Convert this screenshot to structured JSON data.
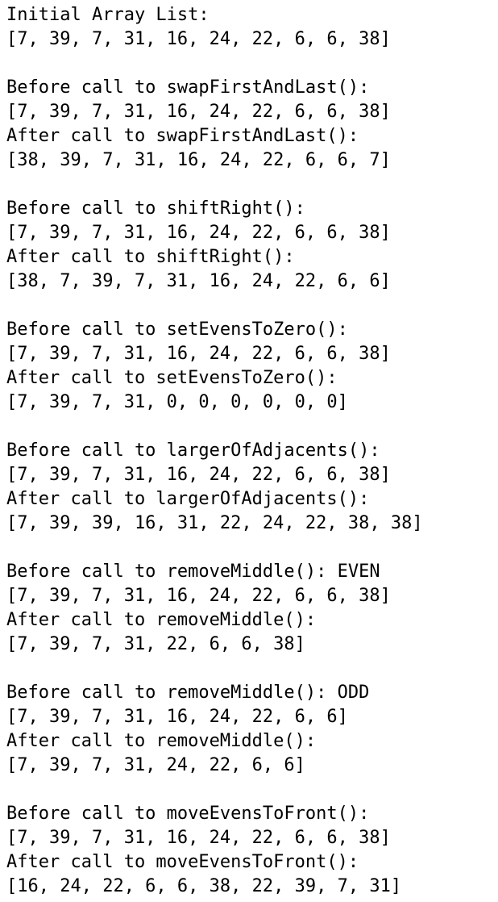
{
  "initial": {
    "label": "Initial Array List:",
    "array": "[7, 39, 7, 31, 16, 24, 22, 6, 6, 38]"
  },
  "sections": [
    {
      "before_label": "Before call to swapFirstAndLast():",
      "before_array": "[7, 39, 7, 31, 16, 24, 22, 6, 6, 38]",
      "after_label": "After call to swapFirstAndLast():",
      "after_array": "[38, 39, 7, 31, 16, 24, 22, 6, 6, 7]"
    },
    {
      "before_label": "Before call to shiftRight():",
      "before_array": "[7, 39, 7, 31, 16, 24, 22, 6, 6, 38]",
      "after_label": "After call to shiftRight():",
      "after_array": "[38, 7, 39, 7, 31, 16, 24, 22, 6, 6]"
    },
    {
      "before_label": "Before call to setEvensToZero():",
      "before_array": "[7, 39, 7, 31, 16, 24, 22, 6, 6, 38]",
      "after_label": "After call to setEvensToZero():",
      "after_array": "[7, 39, 7, 31, 0, 0, 0, 0, 0, 0]"
    },
    {
      "before_label": "Before call to largerOfAdjacents():",
      "before_array": "[7, 39, 7, 31, 16, 24, 22, 6, 6, 38]",
      "after_label": "After call to largerOfAdjacents():",
      "after_array": "[7, 39, 39, 16, 31, 22, 24, 22, 38, 38]"
    },
    {
      "before_label": "Before call to removeMiddle(): EVEN",
      "before_array": "[7, 39, 7, 31, 16, 24, 22, 6, 6, 38]",
      "after_label": "After call to removeMiddle():",
      "after_array": "[7, 39, 7, 31, 22, 6, 6, 38]"
    },
    {
      "before_label": "Before call to removeMiddle(): ODD",
      "before_array": "[7, 39, 7, 31, 16, 24, 22, 6, 6]",
      "after_label": "After call to removeMiddle():",
      "after_array": "[7, 39, 7, 31, 24, 22, 6, 6]"
    },
    {
      "before_label": "Before call to moveEvensToFront():",
      "before_array": "[7, 39, 7, 31, 16, 24, 22, 6, 6, 38]",
      "after_label": "After call to moveEvensToFront():",
      "after_array": "[16, 24, 22, 6, 6, 38, 22, 39, 7, 31]"
    }
  ]
}
